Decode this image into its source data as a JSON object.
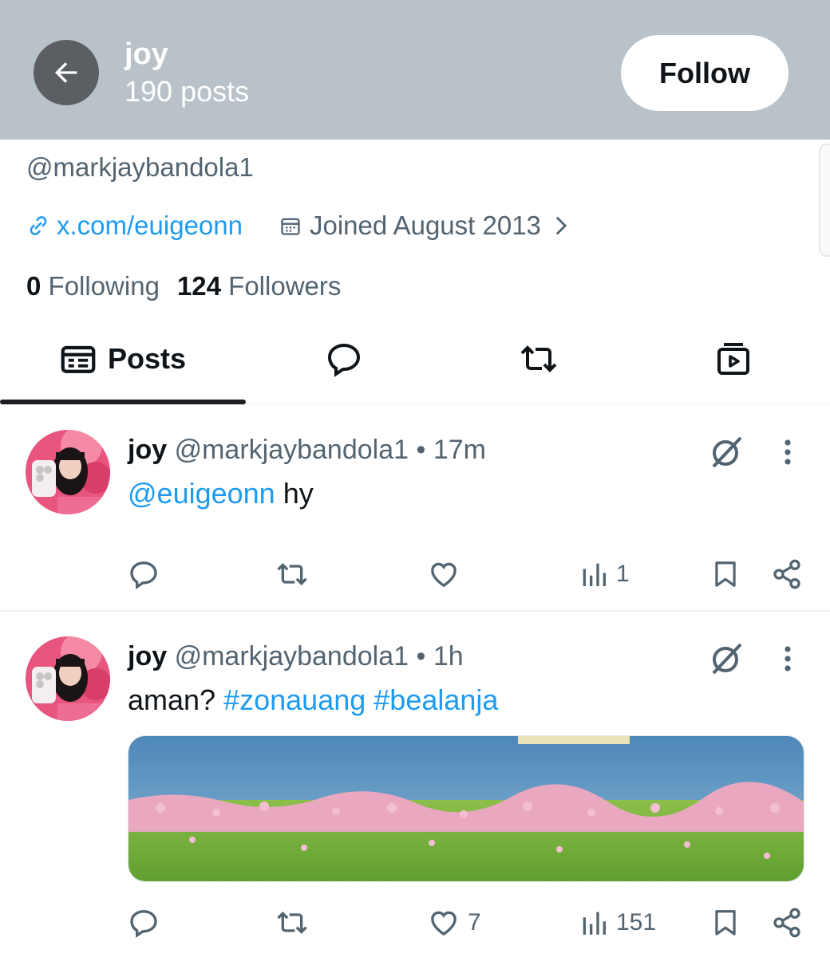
{
  "header": {
    "name": "joy",
    "post_count": "190 posts",
    "follow_label": "Follow",
    "back_icon": "arrow-left-icon"
  },
  "profile": {
    "handle": "@markjaybandola1",
    "website": "x.com/euigeonn",
    "joined": "Joined August 2013",
    "following_count": "0",
    "following_label": "Following",
    "followers_count": "124",
    "followers_label": "Followers"
  },
  "tabs": [
    {
      "label": "Posts",
      "icon": "posts-icon",
      "active": true
    },
    {
      "label": "",
      "icon": "reply-bubble-icon"
    },
    {
      "label": "",
      "icon": "repost-icon"
    },
    {
      "label": "",
      "icon": "media-icon"
    }
  ],
  "posts": [
    {
      "name": "joy",
      "handle": "@markjaybandola1",
      "separator": "•",
      "time": "17m",
      "mention": "@euigeonn",
      "text": "hy",
      "replies": "",
      "reposts": "",
      "likes": "",
      "views": "1"
    },
    {
      "name": "joy",
      "handle": "@markjaybandola1",
      "separator": "•",
      "time": "1h",
      "text": "aman?",
      "hashtags": [
        "#zonauang",
        "#bealanja"
      ],
      "replies": "",
      "reposts": "",
      "likes": "7",
      "views": "151"
    }
  ],
  "colors": {
    "header_bg": "#b8c2c8",
    "accent": "#1d9bf0",
    "secondary_text": "#536471",
    "primary_text": "#0f1419"
  }
}
